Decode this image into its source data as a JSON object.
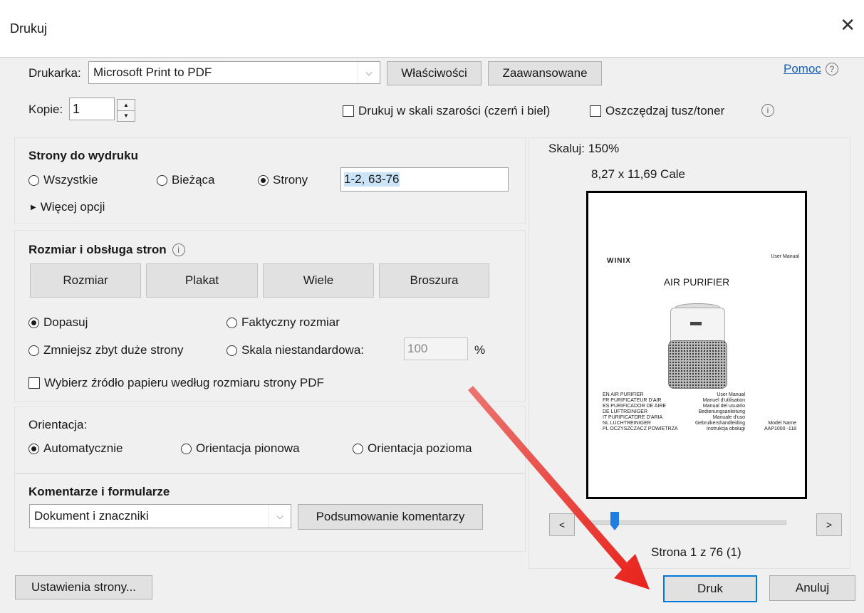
{
  "window": {
    "title": "Drukuj"
  },
  "printer": {
    "label": "Drukarka:",
    "selected": "Microsoft Print to PDF",
    "properties_btn": "Właściwości",
    "advanced_btn": "Zaawansowane",
    "help_link": "Pomoc",
    "copies_label": "Kopie:",
    "copies_value": "1",
    "grayscale_label": "Drukuj w skali szarości (czerń i biel)",
    "grayscale_checked": false,
    "save_ink_label": "Oszczędzaj tusz/toner",
    "save_ink_checked": false
  },
  "pages": {
    "heading": "Strony do wydruku",
    "all": "Wszystkie",
    "current": "Bieżąca",
    "pages": "Strony",
    "selected": "pages",
    "range": "1-2, 63-76",
    "more": "Więcej opcji"
  },
  "sizing": {
    "heading": "Rozmiar i obsługa stron",
    "tabs": [
      "Rozmiar",
      "Plakat",
      "Wiele",
      "Broszura"
    ],
    "fit": "Dopasuj",
    "actual": "Faktyczny rozmiar",
    "shrink": "Zmniejsz zbyt duże strony",
    "custom": "Skala niestandardowa:",
    "custom_value": "100",
    "percent": "%",
    "selected": "fit",
    "paper_source": "Wybierz źródło papieru według rozmiaru strony PDF",
    "paper_source_checked": false
  },
  "orientation": {
    "heading": "Orientacja:",
    "auto": "Automatycznie",
    "portrait": "Orientacja pionowa",
    "landscape": "Orientacja pozioma",
    "selected": "auto"
  },
  "comments": {
    "heading": "Komentarze i formularze",
    "selected": "Dokument i znaczniki",
    "summary_btn": "Podsumowanie komentarzy"
  },
  "preview": {
    "scale": "Skaluj: 150%",
    "size": "8,27 x 11,69 Cale",
    "page_info": "Strona 1 z 76 (1)",
    "prev": "<",
    "next": ">",
    "slider_fraction": 0.0,
    "doc": {
      "brand": "WINIX",
      "corner": "User Manual",
      "title": "AIR PURIFIER",
      "model_label": "Model Name",
      "model": "AAP1000 -118",
      "lines": [
        [
          "EN AIR PURIFIER",
          "User Manual"
        ],
        [
          "FR PURIFICATEUR D'AIR",
          "Manuel d'utilisation"
        ],
        [
          "ES PURIFICADOR DE AIRE",
          "Manual del usuario"
        ],
        [
          "DE LUFTREINIGER",
          "Bedienungsanleitung"
        ],
        [
          "IT PURIFICATORE D'ARIA",
          "Manuale d'uso"
        ],
        [
          "NL LUCHTREINIGER",
          "Gebruikershandleiding"
        ],
        [
          "PL OCZYSZCZACZ POWIETRZA",
          "Instrukcja obsługi"
        ]
      ]
    }
  },
  "footer": {
    "page_setup": "Ustawienia strony...",
    "print": "Druk",
    "cancel": "Anuluj"
  },
  "colors": {
    "arrow": "#e8221b",
    "link": "#1a5fb4",
    "selected_text_bg": "#cce4f7"
  }
}
